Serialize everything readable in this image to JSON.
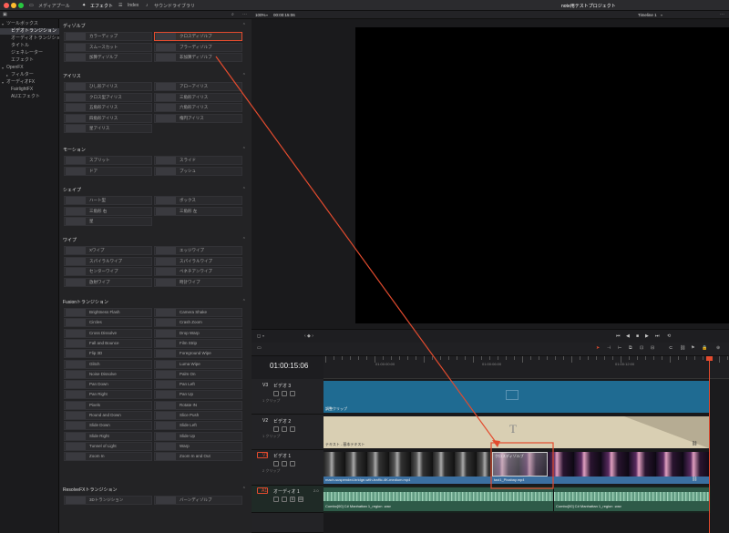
{
  "titlebar": {
    "tabs": [
      {
        "label": "メディアプール",
        "active": false
      },
      {
        "label": "エフェクト",
        "active": true
      },
      {
        "label": "Index",
        "active": false
      },
      {
        "label": "サウンドライブラリ",
        "active": false
      }
    ],
    "project_title": "note用テストプロジェクト",
    "zoom": "100%",
    "timecode": "00:00:15:06",
    "timeline_name": "Timeline 1"
  },
  "sidebar": {
    "items": [
      {
        "label": "ツールボックス",
        "indent": 0,
        "selected": false,
        "arrow": "▾"
      },
      {
        "label": "ビデオトランジション",
        "indent": 1,
        "selected": true,
        "arrow": ""
      },
      {
        "label": "オーディオトランジション",
        "indent": 1,
        "selected": false,
        "arrow": ""
      },
      {
        "label": "タイトル",
        "indent": 1,
        "selected": false,
        "arrow": ""
      },
      {
        "label": "ジェネレーター",
        "indent": 1,
        "selected": false,
        "arrow": ""
      },
      {
        "label": "エフェクト",
        "indent": 1,
        "selected": false,
        "arrow": ""
      },
      {
        "label": "OpenFX",
        "indent": 0,
        "selected": false,
        "arrow": "▾"
      },
      {
        "label": "フィルター",
        "indent": 1,
        "selected": false,
        "arrow": "▸"
      },
      {
        "label": "オーディオFX",
        "indent": 0,
        "selected": false,
        "arrow": "▾"
      },
      {
        "label": "FairlightFX",
        "indent": 1,
        "selected": false,
        "arrow": ""
      },
      {
        "label": "AUエフェクト",
        "indent": 1,
        "selected": false,
        "arrow": ""
      }
    ]
  },
  "library": {
    "sections": [
      {
        "title": "ディゾルブ",
        "items": [
          "カラーディップ",
          "クロスディゾルブ",
          "スムースカット",
          "ブラーディゾルブ",
          "加算ディゾルブ",
          "非加算ディゾルブ"
        ],
        "highlight": 1
      },
      {
        "title": "アイリス",
        "items": [
          "ひし形アイリス",
          "アローアイリス",
          "クロス型アイリス",
          "三角形アイリス",
          "五角形アイリス",
          "六角形アイリス",
          "四角形アイリス",
          "楕円アイリス",
          "星アイリス"
        ],
        "highlight": -1
      },
      {
        "title": "モーション",
        "items": [
          "スプリット",
          "スライド",
          "ドア",
          "プッシュ"
        ],
        "highlight": -1
      },
      {
        "title": "シェイプ",
        "items": [
          "ハート型",
          "ボックス",
          "三角形 右",
          "三角形 左",
          "星"
        ],
        "highlight": -1
      },
      {
        "title": "ワイプ",
        "items": [
          "Xワイプ",
          "エッジワイプ",
          "スパイラルワイプ",
          "スパイラルワイプ",
          "センターワイプ",
          "ベネチアンワイプ",
          "放射ワイプ",
          "時計ワイプ"
        ],
        "highlight": -1
      },
      {
        "title": "Fusionトランジション",
        "items": [
          "Brightness Flash",
          "Camera Shake",
          "Circles",
          "Crash Zoom",
          "Cross Dissolve",
          "Drop Warp",
          "Fall and Bounce",
          "Film Strip",
          "Flip 3D",
          "Foreground Wipe",
          "Glitch",
          "Luma Wipe",
          "Noise Dissolve",
          "Palm On",
          "Pan Down",
          "Pan Left",
          "Pan Right",
          "Pan Up",
          "Pixels",
          "Rotate IN",
          "Round and Down",
          "Slice Push",
          "Slide Down",
          "Slide Left",
          "Slide Right",
          "Slide Up",
          "Tunnel of Light",
          "Warp",
          "Zoom In",
          "Zoom In and Out"
        ],
        "highlight": -1
      },
      {
        "title": "ResolveFXトランジション",
        "items": [
          "3Dトランジション",
          "バーンディゾルブ"
        ],
        "highlight": -1
      }
    ]
  },
  "timeline": {
    "current_timecode": "01:00:15:06",
    "ruler_labels": [
      "01:00:00:00",
      "01:00:06:00",
      "01:00:12:00"
    ],
    "tracks": [
      {
        "id": "V3",
        "name": "ビデオ 3",
        "clips_label": "1 クリップ",
        "clip": "調整クリップ"
      },
      {
        "id": "V2",
        "name": "ビデオ 2",
        "clips_label": "1 クリップ",
        "clip": "テキスト - 基本テキスト"
      },
      {
        "id": "V1",
        "name": "ビデオ 1",
        "clips_label": "2 クリップ",
        "clip_a": "mach-suspended-bridge-with-traffic-4K-medium.mp4",
        "clip_b": "taxi1_Pixabay.mp4",
        "transition": "クロスディゾルブ"
      },
      {
        "id": "A1",
        "name": "オーディオ 1",
        "level": "2.0",
        "clip_a": "Combo[00] C# Manhattan 1_region .wav",
        "clip_b": "Combo[00] C# Manhattan 1_region .wav"
      }
    ]
  },
  "colors": {
    "accent": "#e34b2e",
    "v3": "#1f6b92",
    "v2": "#d9cfb3",
    "v1": "#3b6fa0",
    "a1": "#2e5a48"
  }
}
